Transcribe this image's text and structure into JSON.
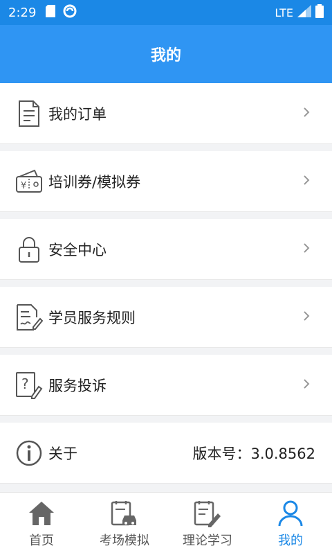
{
  "status_bar": {
    "time": "2:29",
    "network": "LTE"
  },
  "header": {
    "title": "我的"
  },
  "menu": [
    {
      "label": "我的订单",
      "icon": "document-icon"
    },
    {
      "label": "培训券/模拟券",
      "icon": "coupon-wallet-icon"
    },
    {
      "label": "安全中心",
      "icon": "lock-icon"
    },
    {
      "label": "学员服务规则",
      "icon": "signed-document-icon"
    },
    {
      "label": "服务投诉",
      "icon": "question-document-icon"
    }
  ],
  "about": {
    "label": "关于",
    "version": "版本号：3.0.8562",
    "icon": "info-icon"
  },
  "tabs": [
    {
      "label": "首页",
      "icon": "home-icon",
      "active": false
    },
    {
      "label": "考场模拟",
      "icon": "exam-car-icon",
      "active": false
    },
    {
      "label": "理论学习",
      "icon": "notebook-pen-icon",
      "active": false
    },
    {
      "label": "我的",
      "icon": "person-icon",
      "active": true
    }
  ],
  "colors": {
    "primary": "#2f95f3",
    "status_bar": "#1b88e6",
    "active_tab": "#1b88e6"
  }
}
